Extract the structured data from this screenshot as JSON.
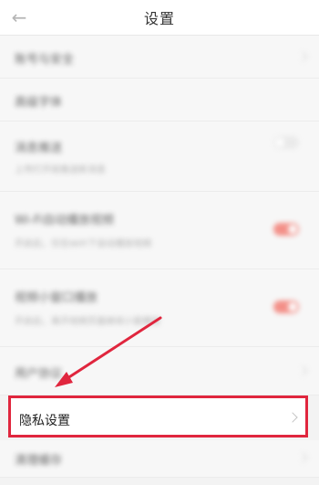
{
  "header": {
    "title": "设置",
    "back_icon": "arrow-left-icon"
  },
  "rows": [
    {
      "label": "账号与安全"
    },
    {
      "label": "高级字体"
    },
    {
      "label": "消息推送",
      "sub": "上传打开就推送新消息"
    },
    {
      "label": "Wi-Fi自动播放视频",
      "sub": "开启后，仅在WiFi下自动播放视频"
    },
    {
      "label": "视频小窗口播放",
      "sub": "开启后，离开视频页面继续小窗播放"
    },
    {
      "label": "用户协议"
    },
    {
      "label": "隐私设置"
    },
    {
      "label": "清理缓存"
    }
  ],
  "colors": {
    "accent": "#e0263e",
    "toggle_on": "#f26d63"
  }
}
